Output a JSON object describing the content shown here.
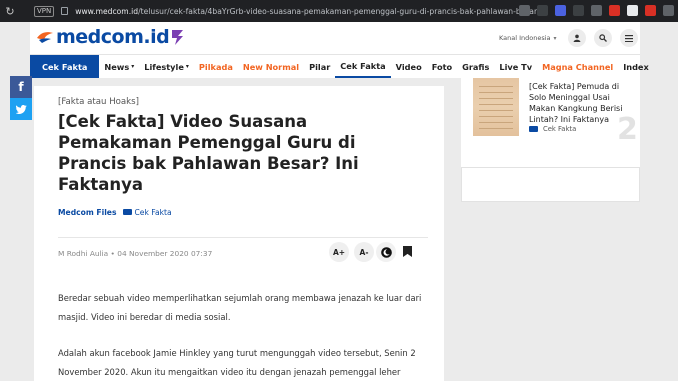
{
  "browser": {
    "vpn_label": "VPN",
    "url_host": "www.medcom.id",
    "url_path": "/telusur/cek-fakta/4baYrGrb-video-suasana-pemakaman-pemenggal-guru-di-prancis-bak-pahlawan-besar-i"
  },
  "header": {
    "logo_text": "medcom.id",
    "kanal_label": "Kanal Indonesia",
    "colors": {
      "brand": "#0a4aa3",
      "accent": "#f26522"
    }
  },
  "nav": {
    "items": [
      {
        "label": "Cek Fakta",
        "style": "first"
      },
      {
        "label": "News",
        "caret": true
      },
      {
        "label": "Lifestyle",
        "caret": true
      },
      {
        "label": "Pilkada",
        "style": "hl"
      },
      {
        "label": "New Normal",
        "style": "hl"
      },
      {
        "label": "Pilar"
      },
      {
        "label": "Cek Fakta",
        "style": "active"
      },
      {
        "label": "Video"
      },
      {
        "label": "Foto"
      },
      {
        "label": "Grafis"
      },
      {
        "label": "Live Tv"
      },
      {
        "label": "Magna Channel",
        "style": "hl"
      },
      {
        "label": "Index"
      }
    ]
  },
  "share": {
    "facebook": "f",
    "twitter": "t"
  },
  "article": {
    "kicker": "[Fakta atau Hoaks]",
    "title": "[Cek Fakta] Video Suasana Pemakaman Pemenggal Guru di Prancis bak Pahlawan Besar? Ini Faktanya",
    "author": "Medcom Files",
    "category": "Cek Fakta",
    "byline": "M Rodhi Aulia • 04 November 2020 07:37",
    "tools": {
      "font_up": "A+",
      "font_down": "A-"
    },
    "paragraphs": [
      "Beredar sebuah video memperlihatkan sejumlah orang membawa jenazah ke luar dari masjid. Video ini beredar di media sosial.",
      "Adalah akun facebook Jamie Hinkley yang turut mengunggah video tersebut, Senin 2 November 2020. Akun itu mengaitkan video itu dengan jenazah pemenggal leher"
    ]
  },
  "sidebar": {
    "title": "[Cek Fakta] Pemuda di Solo Meninggal Usai Makan Kangkung Berisi Lintah? Ini Faktanya",
    "category": "Cek Fakta",
    "number": "2"
  }
}
